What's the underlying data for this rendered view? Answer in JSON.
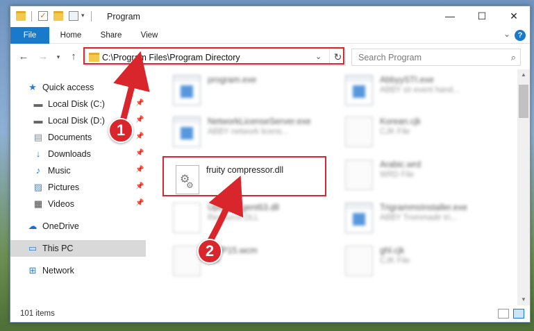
{
  "window": {
    "title": "Program",
    "controls": {
      "minimize": "—",
      "maximize": "☐",
      "close": "✕"
    }
  },
  "ribbon": {
    "tabs": [
      "File",
      "Home",
      "Share",
      "View"
    ]
  },
  "navbar": {
    "address": "C:\\Program Files\\Program Directory",
    "search_placeholder": "Search Program"
  },
  "sidebar": {
    "items": [
      {
        "label": "Quick access",
        "icon": "star-icon",
        "pinned": false
      },
      {
        "label": "Local Disk (C:)",
        "icon": "drive-icon",
        "pinned": true
      },
      {
        "label": "Local Disk (D:)",
        "icon": "drive-icon",
        "pinned": true
      },
      {
        "label": "Documents",
        "icon": "documents-icon",
        "pinned": true
      },
      {
        "label": "Downloads",
        "icon": "download-icon",
        "pinned": true
      },
      {
        "label": "Music",
        "icon": "music-icon",
        "pinned": true
      },
      {
        "label": "Pictures",
        "icon": "pictures-icon",
        "pinned": true
      },
      {
        "label": "Videos",
        "icon": "videos-icon",
        "pinned": true
      },
      {
        "label": "OneDrive",
        "icon": "cloud-icon",
        "pinned": false
      },
      {
        "label": "This PC",
        "icon": "computer-icon",
        "pinned": false,
        "selected": true
      },
      {
        "label": "Network",
        "icon": "network-icon",
        "pinned": false
      }
    ]
  },
  "files": [
    {
      "name": "program.exe",
      "desc": "",
      "type": "exe"
    },
    {
      "name": "AbbyySTI.exe",
      "desc": "ABBY sti event hand...",
      "type": "exe"
    },
    {
      "name": "NetworkLicenseServer.exe",
      "desc": "ABBY network licens...",
      "type": "exe"
    },
    {
      "name": "Korean.cjk",
      "desc": "CJK File",
      "type": "doc"
    },
    {
      "name": "fruity compressor.dll",
      "desc": "",
      "type": "dll",
      "highlighted": true
    },
    {
      "name": "Arabic.wrd",
      "desc": "WRD File",
      "type": "doc"
    },
    {
      "name": "UpdateAgent63.dll",
      "desc": "Resource DLL",
      "type": "dll"
    },
    {
      "name": "TrigrammsInstaller.exe",
      "desc": "ABBY Trommadir tri...",
      "type": "exe"
    },
    {
      "name": "SWP15.wcm",
      "desc": "File",
      "type": "doc"
    },
    {
      "name": "ghl.cjk",
      "desc": "CJK File",
      "type": "doc"
    }
  ],
  "status": {
    "item_count": "101 items"
  },
  "annotations": {
    "step1": "1",
    "step2": "2",
    "accent": "#d9262c"
  },
  "colors": {
    "ribbon_file_tab": "#1979ca",
    "selection": "#d9d9d9"
  }
}
